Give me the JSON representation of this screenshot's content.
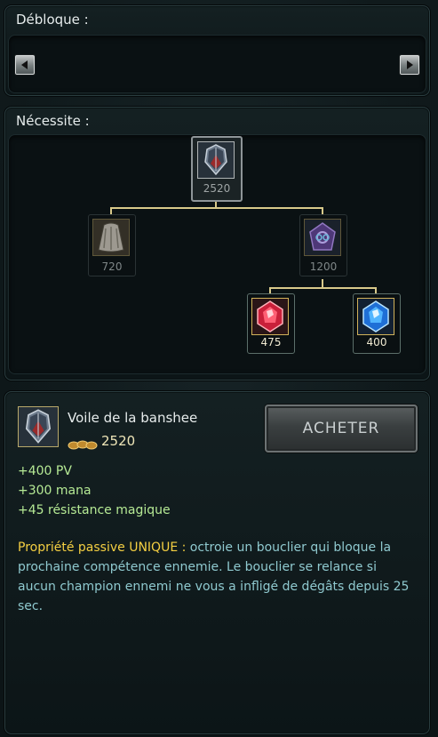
{
  "unlocks": {
    "title": "Débloque :"
  },
  "requires": {
    "title": "Nécessite :",
    "root": {
      "name": "Voile de la banshee",
      "price": "2520",
      "icon": "banshee-veil-icon"
    },
    "children": [
      {
        "name": "cape",
        "price": "720",
        "icon": "cloak-icon"
      },
      {
        "name": "amulette",
        "price": "1200",
        "icon": "amulet-icon"
      }
    ],
    "grandchildren": [
      {
        "name": "cristal rouge",
        "price": "475",
        "icon": "ruby-crystal-icon"
      },
      {
        "name": "cristal bleu",
        "price": "400",
        "icon": "sapphire-crystal-icon"
      }
    ]
  },
  "detail": {
    "name": "Voile de la banshee",
    "price": "2520",
    "icon": "banshee-veil-icon",
    "buy_label": "ACHETER",
    "stats": [
      "+400 PV",
      "+300 mana",
      "+45 résistance magique"
    ],
    "passive_label": "Propriété passive UNIQUE :",
    "passive_text": " octroie un bouclier qui bloque la prochaine compétence ennemie. Le bouclier se relance si aucun champion ennemi ne vous a infligé de dégâts depuis 25 sec."
  }
}
